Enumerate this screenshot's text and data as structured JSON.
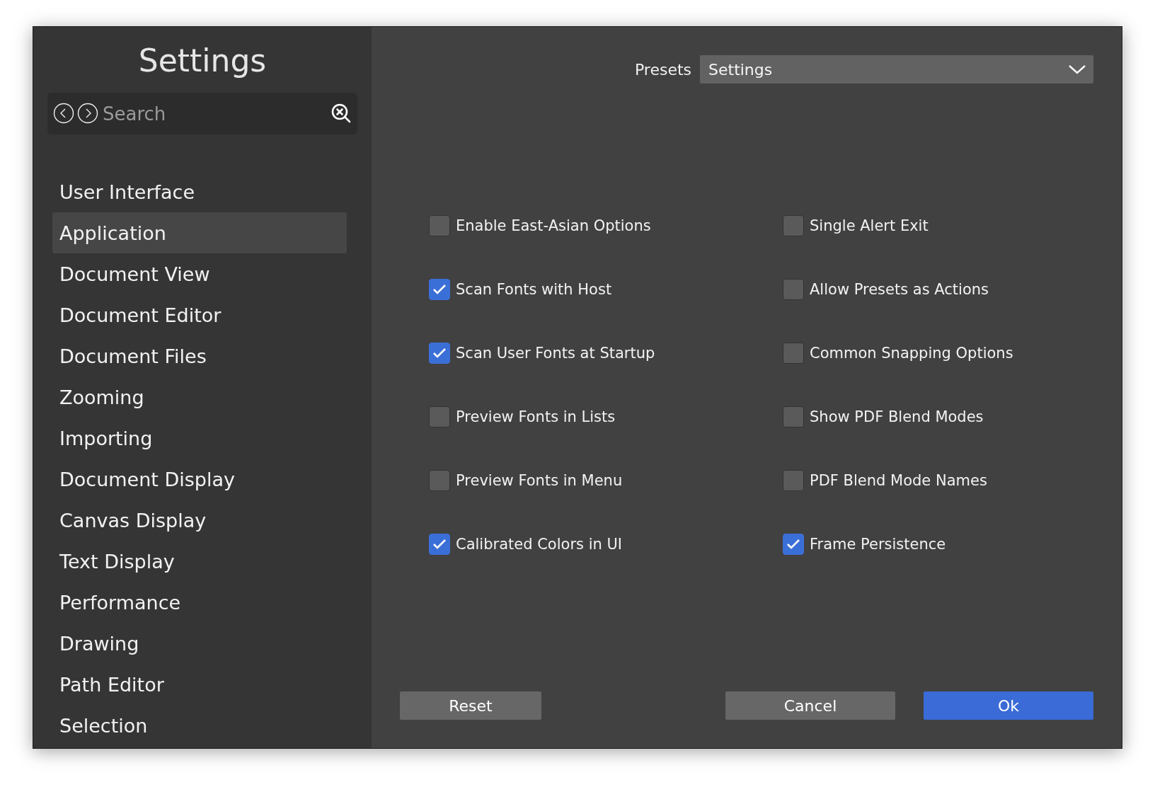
{
  "sidebar": {
    "title": "Settings",
    "search": {
      "placeholder": "Search"
    },
    "items": [
      {
        "label": "User Interface",
        "selected": false
      },
      {
        "label": "Application",
        "selected": true
      },
      {
        "label": "Document View",
        "selected": false
      },
      {
        "label": "Document Editor",
        "selected": false
      },
      {
        "label": "Document Files",
        "selected": false
      },
      {
        "label": "Zooming",
        "selected": false
      },
      {
        "label": "Importing",
        "selected": false
      },
      {
        "label": "Document Display",
        "selected": false
      },
      {
        "label": "Canvas Display",
        "selected": false
      },
      {
        "label": "Text Display",
        "selected": false
      },
      {
        "label": "Performance",
        "selected": false
      },
      {
        "label": "Drawing",
        "selected": false
      },
      {
        "label": "Path Editor",
        "selected": false
      },
      {
        "label": "Selection",
        "selected": false
      }
    ]
  },
  "presets": {
    "label": "Presets",
    "value": "Settings"
  },
  "options": [
    {
      "label": "Enable East-Asian Options",
      "checked": false
    },
    {
      "label": "Single Alert Exit",
      "checked": false
    },
    {
      "label": "Scan Fonts with Host",
      "checked": true
    },
    {
      "label": "Allow Presets as Actions",
      "checked": false
    },
    {
      "label": "Scan User Fonts at Startup",
      "checked": true
    },
    {
      "label": "Common Snapping Options",
      "checked": false
    },
    {
      "label": "Preview Fonts in Lists",
      "checked": false
    },
    {
      "label": "Show PDF Blend Modes",
      "checked": false
    },
    {
      "label": "Preview Fonts in Menu",
      "checked": false
    },
    {
      "label": "PDF Blend Mode Names",
      "checked": false
    },
    {
      "label": "Calibrated Colors in UI",
      "checked": true
    },
    {
      "label": "Frame Persistence",
      "checked": true
    }
  ],
  "buttons": [
    {
      "label": "Reset",
      "kind": "secondary"
    },
    {
      "label": "Cancel",
      "kind": "secondary"
    },
    {
      "label": "Ok",
      "kind": "primary"
    }
  ]
}
